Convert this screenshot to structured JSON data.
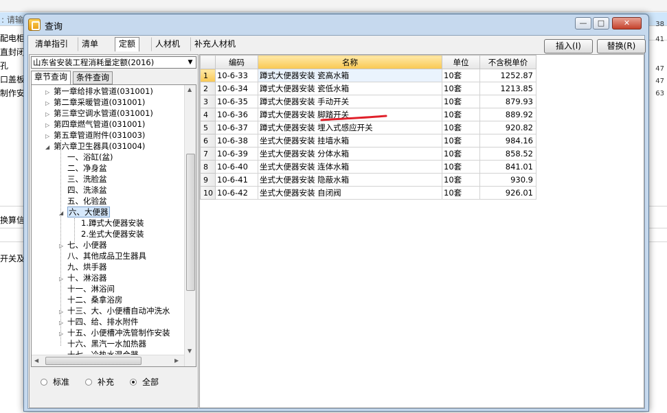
{
  "background": {
    "top_hint": ": 请输",
    "left_rows": [
      "配电柜",
      "直封闭",
      "孔",
      "口盖板",
      "制作安"
    ],
    "right_numbers": [
      "38",
      "41",
      "47",
      "47",
      "63"
    ],
    "section_label": "换算信",
    "bottom_text": "开关及"
  },
  "dialog": {
    "title": "查询",
    "window_buttons": {
      "minimize": "—",
      "maximize": "□",
      "close": "✕"
    },
    "toolbar_tabs": [
      "清单指引",
      "清单",
      "定额",
      "人材机",
      "补充人材机"
    ],
    "selected_toolbar_tab": "定额",
    "insert_button": "插入(I)",
    "replace_button": "替换(R)"
  },
  "left_panel": {
    "quota_select": "山东省安装工程消耗量定额(2016)",
    "tabs": [
      "章节查询",
      "条件查询"
    ],
    "tree": [
      {
        "label": "第一章给排水管道(031001)",
        "level": 0,
        "expander": "▷"
      },
      {
        "label": "第二章采暖管道(031001)",
        "level": 0,
        "expander": "▷"
      },
      {
        "label": "第三章空调水管道(031001)",
        "level": 0,
        "expander": "▷"
      },
      {
        "label": "第四章燃气管道(031001)",
        "level": 0,
        "expander": "▷"
      },
      {
        "label": "第五章管道附件(031003)",
        "level": 0,
        "expander": "▷"
      },
      {
        "label": "第六章卫生器具(031004)",
        "level": 0,
        "expander": "◢"
      },
      {
        "label": "一、浴缸(盆)",
        "level": 1,
        "expander": ""
      },
      {
        "label": "二、净身盆",
        "level": 1,
        "expander": ""
      },
      {
        "label": "三、洗脸盆",
        "level": 1,
        "expander": ""
      },
      {
        "label": "四、洗涤盆",
        "level": 1,
        "expander": ""
      },
      {
        "label": "五、化验盆",
        "level": 1,
        "expander": ""
      },
      {
        "label": "六、大便器",
        "level": 1,
        "expander": "◢",
        "selected": true
      },
      {
        "label": "1.蹲式大便器安装",
        "level": 2,
        "expander": ""
      },
      {
        "label": "2.坐式大便器安装",
        "level": 2,
        "expander": ""
      },
      {
        "label": "七、小便器",
        "level": 1,
        "expander": "▷"
      },
      {
        "label": "八、其他成品卫生器具",
        "level": 1,
        "expander": ""
      },
      {
        "label": "九、烘手器",
        "level": 1,
        "expander": ""
      },
      {
        "label": "十、淋浴器",
        "level": 1,
        "expander": "▷"
      },
      {
        "label": "十一、淋浴间",
        "level": 1,
        "expander": ""
      },
      {
        "label": "十二、桑拿浴房",
        "level": 1,
        "expander": ""
      },
      {
        "label": "十三、大、小便槽自动冲洗水",
        "level": 1,
        "expander": "▷"
      },
      {
        "label": "十四、给、排水附件",
        "level": 1,
        "expander": "▷"
      },
      {
        "label": "十五、小便槽冲洗管制作安装",
        "level": 1,
        "expander": "▷"
      },
      {
        "label": "十六、黑汽一水加热器",
        "level": 1,
        "expander": ""
      },
      {
        "label": "十七、冷热水混合器",
        "level": 1,
        "expander": ""
      }
    ],
    "radios": [
      {
        "label": "标准",
        "checked": false
      },
      {
        "label": "补充",
        "checked": false
      },
      {
        "label": "全部",
        "checked": true
      }
    ]
  },
  "table": {
    "columns": [
      "",
      "编码",
      "名称",
      "单位",
      "不含税单价"
    ],
    "rows": [
      {
        "no": "1",
        "code": "10-6-33",
        "name": "蹲式大便器安装 瓷高水箱",
        "unit": "10套",
        "price": "1252.87"
      },
      {
        "no": "2",
        "code": "10-6-34",
        "name": "蹲式大便器安装 瓷低水箱",
        "unit": "10套",
        "price": "1213.85"
      },
      {
        "no": "3",
        "code": "10-6-35",
        "name": "蹲式大便器安装 手动开关",
        "unit": "10套",
        "price": "879.93"
      },
      {
        "no": "4",
        "code": "10-6-36",
        "name": "蹲式大便器安装 脚踏开关",
        "unit": "10套",
        "price": "889.92"
      },
      {
        "no": "5",
        "code": "10-6-37",
        "name": "蹲式大便器安装 埋入式感应开关",
        "unit": "10套",
        "price": "920.82"
      },
      {
        "no": "6",
        "code": "10-6-38",
        "name": "坐式大便器安装 挂墙水箱",
        "unit": "10套",
        "price": "984.16"
      },
      {
        "no": "7",
        "code": "10-6-39",
        "name": "坐式大便器安装 分体水箱",
        "unit": "10套",
        "price": "858.52"
      },
      {
        "no": "8",
        "code": "10-6-40",
        "name": "坐式大便器安装 连体水箱",
        "unit": "10套",
        "price": "841.01"
      },
      {
        "no": "9",
        "code": "10-6-41",
        "name": "坐式大便器安装 隐蔽水箱",
        "unit": "10套",
        "price": "930.9"
      },
      {
        "no": "10",
        "code": "10-6-42",
        "name": "坐式大便器安装 自闭阀",
        "unit": "10套",
        "price": "926.01"
      }
    ],
    "selected_row": 1
  },
  "colors": {
    "accent": "#f9c852",
    "highlight_stroke": "#e0202a",
    "selection": "#d6e8fb"
  }
}
